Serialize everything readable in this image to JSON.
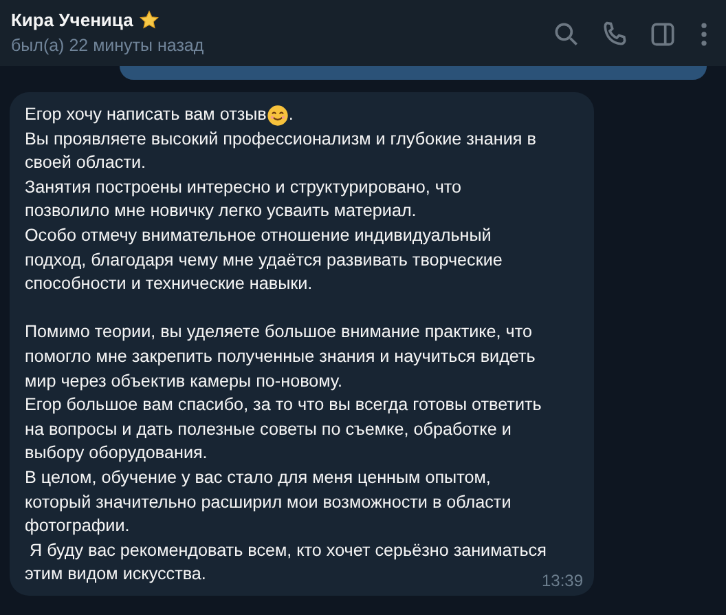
{
  "header": {
    "title": "Кира Ученица",
    "status": "был(а) 22 минуты назад"
  },
  "message": {
    "first_line_before": "Егор хочу написать вам отзыв",
    "first_line_after": ".",
    "body": "Вы проявляете высокий профессионализм и глубокие знания в\nсвоей области.\nЗанятия построены интересно и структурировано, что\nпозволило мне новичку легко усваить материал.\nОсобо отмечу внимательное отношение индивидуальный\nподход, благодаря чему мне удаётся развивать творческие\nспособности и технические навыки.\n\nПомимо теории, вы уделяете большое внимание практике, что\nпомогло мне закрепить полученные знания и научиться видеть\nмир через объектив камеры по-новому.\nЕгор большое вам спасибо, за то что вы всегда готовы ответить\nна вопросы и дать полезные советы по съемке, обработке и\nвыбору оборудования.\nВ целом, обучение у вас стало для меня ценным опытом,\nкоторый значительно расширил мои возможности в области\nфотографии.\n Я буду вас рекомендовать всем, кто хочет серьёзно заниматься\nэтим видом искусства.",
    "time": "13:39"
  }
}
